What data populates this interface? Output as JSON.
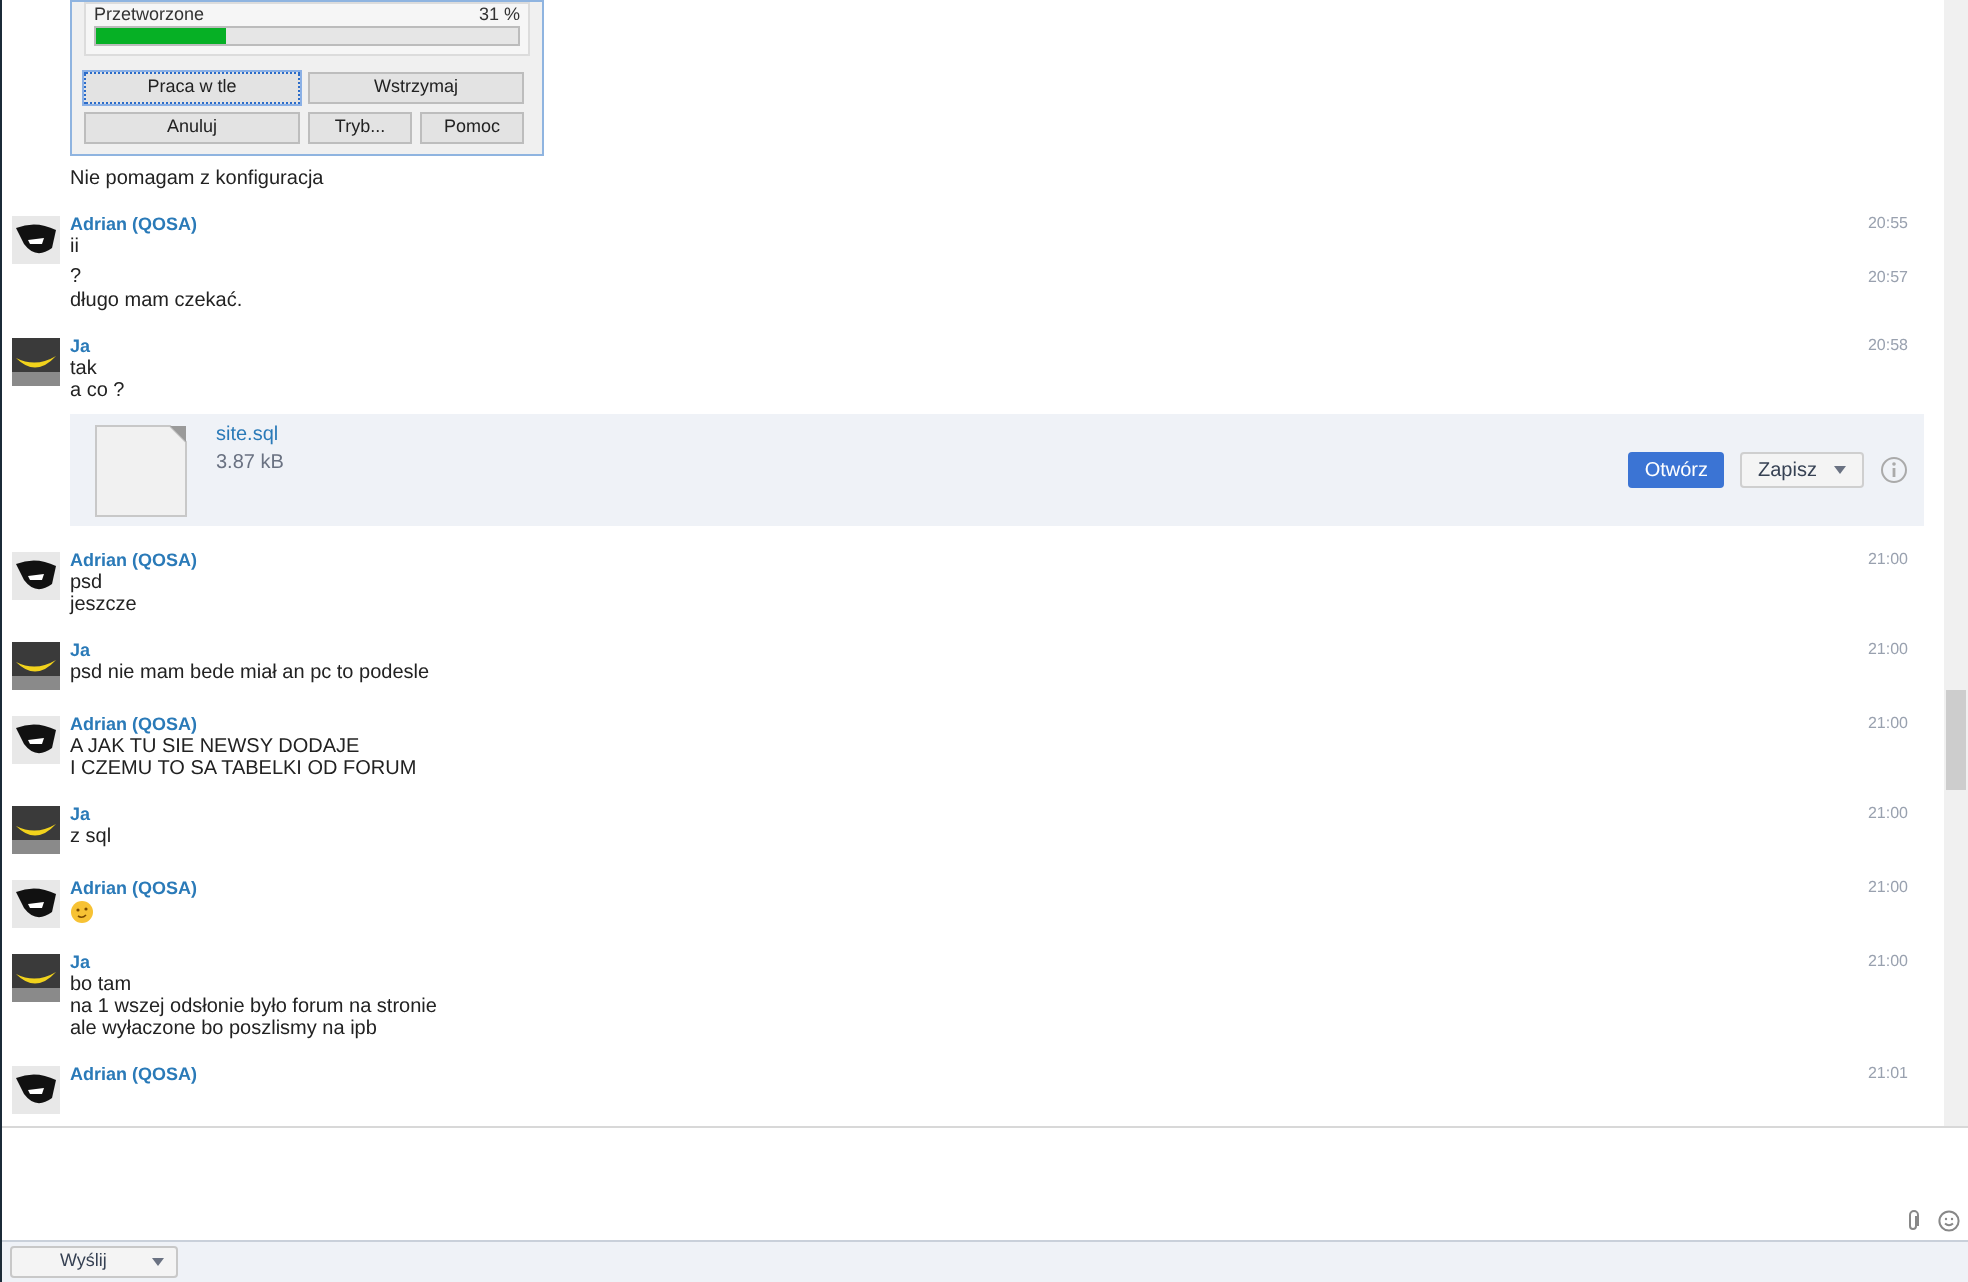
{
  "dialog": {
    "progress_label": "Przetworzone",
    "progress_reading": "31 %",
    "level": 0.31,
    "buttons": [
      {
        "label": "Praca w tle",
        "focused": true
      },
      {
        "label": "Wstrzymaj",
        "focused": false
      },
      {
        "label": "Anuluj",
        "focused": false
      },
      {
        "label": "Tryb...",
        "focused": false
      },
      {
        "label": "Pomoc",
        "focused": false
      }
    ]
  },
  "lead_text": "Nie pomagam z konfiguracja",
  "messages": [
    {
      "sender": "Adrian (QOSA)",
      "kind": "contact",
      "time": "20:55",
      "lines": [
        {
          "kind": "text",
          "text": "ii"
        },
        {
          "kind": "text",
          "text": "?",
          "time": "20:57"
        },
        {
          "kind": "text",
          "text": "długo mam czekać."
        }
      ]
    },
    {
      "sender": "Ja",
      "kind": "self",
      "time": "20:58",
      "lines": [
        {
          "kind": "text",
          "text": "tak"
        },
        {
          "kind": "text",
          "text": "a co ?"
        },
        {
          "kind": "file",
          "name": "site.sql",
          "size": "3.87 kB",
          "open": "Otwórz",
          "save": "Zapisz"
        }
      ]
    },
    {
      "sender": "Adrian (QOSA)",
      "kind": "contact",
      "time": "21:00",
      "lines": [
        {
          "kind": "text",
          "text": "psd"
        },
        {
          "kind": "text",
          "text": "jeszcze"
        }
      ]
    },
    {
      "sender": "Ja",
      "kind": "self",
      "time": "21:00",
      "lines": [
        {
          "kind": "text",
          "text": "psd nie mam bede miał an pc to podesle"
        }
      ]
    },
    {
      "sender": "Adrian (QOSA)",
      "kind": "contact",
      "time": "21:00",
      "lines": [
        {
          "kind": "text",
          "text": "A JAK TU SIE NEWSY DODAJE"
        },
        {
          "kind": "text",
          "text": "I CZEMU TO SA TABELKI OD FORUM"
        }
      ]
    },
    {
      "sender": "Ja",
      "kind": "self",
      "time": "21:00",
      "lines": [
        {
          "kind": "text",
          "text": "z sql"
        }
      ]
    },
    {
      "sender": "Adrian (QOSA)",
      "kind": "contact",
      "time": "21:00",
      "lines": [
        {
          "kind": "emoji"
        }
      ]
    },
    {
      "sender": "Ja",
      "kind": "self",
      "time": "21:00",
      "lines": [
        {
          "kind": "text",
          "text": "bo tam"
        },
        {
          "kind": "text",
          "text": "na 1 wszej odsłonie było forum na stronie"
        },
        {
          "kind": "text",
          "text": "ale wyłaczone bo poszlismy na ipb"
        }
      ]
    },
    {
      "sender": "Adrian (QOSA)",
      "kind": "contact",
      "time": "21:01"
    }
  ],
  "send_button": "Wyślij"
}
